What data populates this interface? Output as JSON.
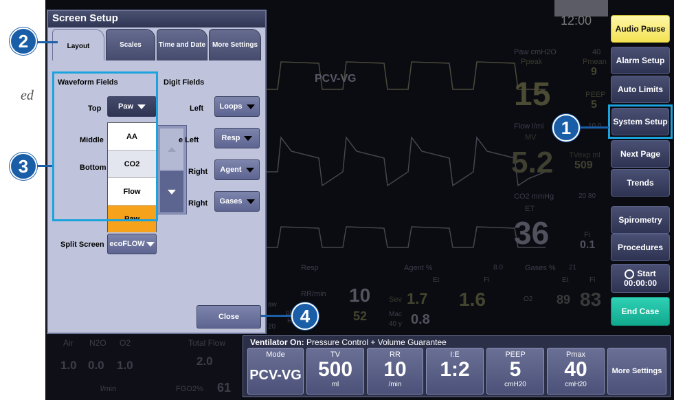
{
  "background_text": {
    "partial_word": "ed"
  },
  "monitor": {
    "clock": "12:00",
    "waveform_label": "PCV-VG",
    "paw": {
      "title": "Paw cmH2O",
      "limit": "40",
      "ppeak": "Ppeak",
      "pmean": "Pmean",
      "pmean_val": "9",
      "big": "15",
      "peep": "PEEP",
      "peep_val": "5"
    },
    "flow": {
      "title": "Flow l/mi",
      "limit": "10.0",
      "mv": "MV",
      "big": "5.2",
      "tvexp": "TVexp ml",
      "tvexp_val": "509"
    },
    "co2": {
      "title": "CO2 mmHg",
      "limits": "20  80",
      "et": "ET",
      "big": "36",
      "fi": "Fi",
      "fi_val": "0.1"
    },
    "resp": {
      "title": "Resp",
      "rr": "RR/min",
      "rr_val": "10",
      "val2": "52",
      "aw": "aw",
      "h2o": "H2O",
      "pl": "pl",
      "twenty": "20"
    },
    "agent": {
      "title": "Agent %",
      "limit": "8.0",
      "et": "Et",
      "fi": "Fi",
      "sev": "Sev",
      "sev_et": "1.7",
      "sev_fi": "1.6",
      "mac": "Mac",
      "age": "40 y",
      "mac_val": "0.8"
    },
    "gases": {
      "title": "Gases %",
      "limit": "21",
      "et": "Et",
      "fi": "Fi",
      "o2": "O2",
      "o2_et": "89",
      "o2_fi": "83"
    },
    "fresh": {
      "air": "Air",
      "n2o": "N2O",
      "o2": "O2",
      "air_v": "1.0",
      "n2o_v": "0.0",
      "o2_v": "1.0",
      "unit": "l/min",
      "total": "Total Flow",
      "total_v": "2.0",
      "fgo2": "FGO2%",
      "fgo2_v": "61"
    }
  },
  "sidebar": {
    "audio_pause": "Audio Pause",
    "alarm_setup": "Alarm Setup",
    "auto_limits": "Auto Limits",
    "system_setup": "System Setup",
    "next_page": "Next Page",
    "trends": "Trends",
    "spirometry": "Spirometry",
    "procedures": "Procedures",
    "start": "Start",
    "timer": "00:00:00",
    "end_case": "End Case"
  },
  "dialog": {
    "title": "Screen Setup",
    "tabs": [
      "Layout",
      "Scales",
      "Time and Date",
      "More Settings"
    ],
    "waveform_fields": "Waveform Fields",
    "digit_fields": "Digit Fields",
    "top": "Top",
    "middle": "Middle",
    "bottom": "Bottom",
    "top_value": "Paw",
    "dropdown_options": [
      "AA",
      "CO2",
      "Flow",
      "Paw"
    ],
    "digit_rows": [
      {
        "label": "Left",
        "value": "Loops"
      },
      {
        "label": "e Left",
        "value": "Resp"
      },
      {
        "label": "Right",
        "value": "Agent"
      },
      {
        "label": "Right",
        "value": "Gases"
      }
    ],
    "split_screen": "Split Screen",
    "split_value": "ecoFLOW",
    "close": "Close"
  },
  "ventilator": {
    "status_bold": "Ventilator On:",
    "status_text": " Pressure Control + Volume Guarantee",
    "cells": [
      {
        "title": "Mode",
        "value": "PCV-VG",
        "unit": ""
      },
      {
        "title": "TV",
        "value": "500",
        "unit": "ml"
      },
      {
        "title": "RR",
        "value": "10",
        "unit": "/min"
      },
      {
        "title": "I:E",
        "value": "1:2",
        "unit": ""
      },
      {
        "title": "PEEP",
        "value": "5",
        "unit": "cmH20"
      },
      {
        "title": "Pmax",
        "value": "40",
        "unit": "cmH20"
      }
    ],
    "more_settings": "More Settings"
  },
  "markers": [
    "1",
    "2",
    "3",
    "4"
  ],
  "colors": {
    "highlight_frame": "#1aa3dc",
    "marker_blue": "#1b5ea8",
    "selected_option": "#f7a21b",
    "audio_pause": "#f3e252",
    "end_case": "#11a98e"
  }
}
